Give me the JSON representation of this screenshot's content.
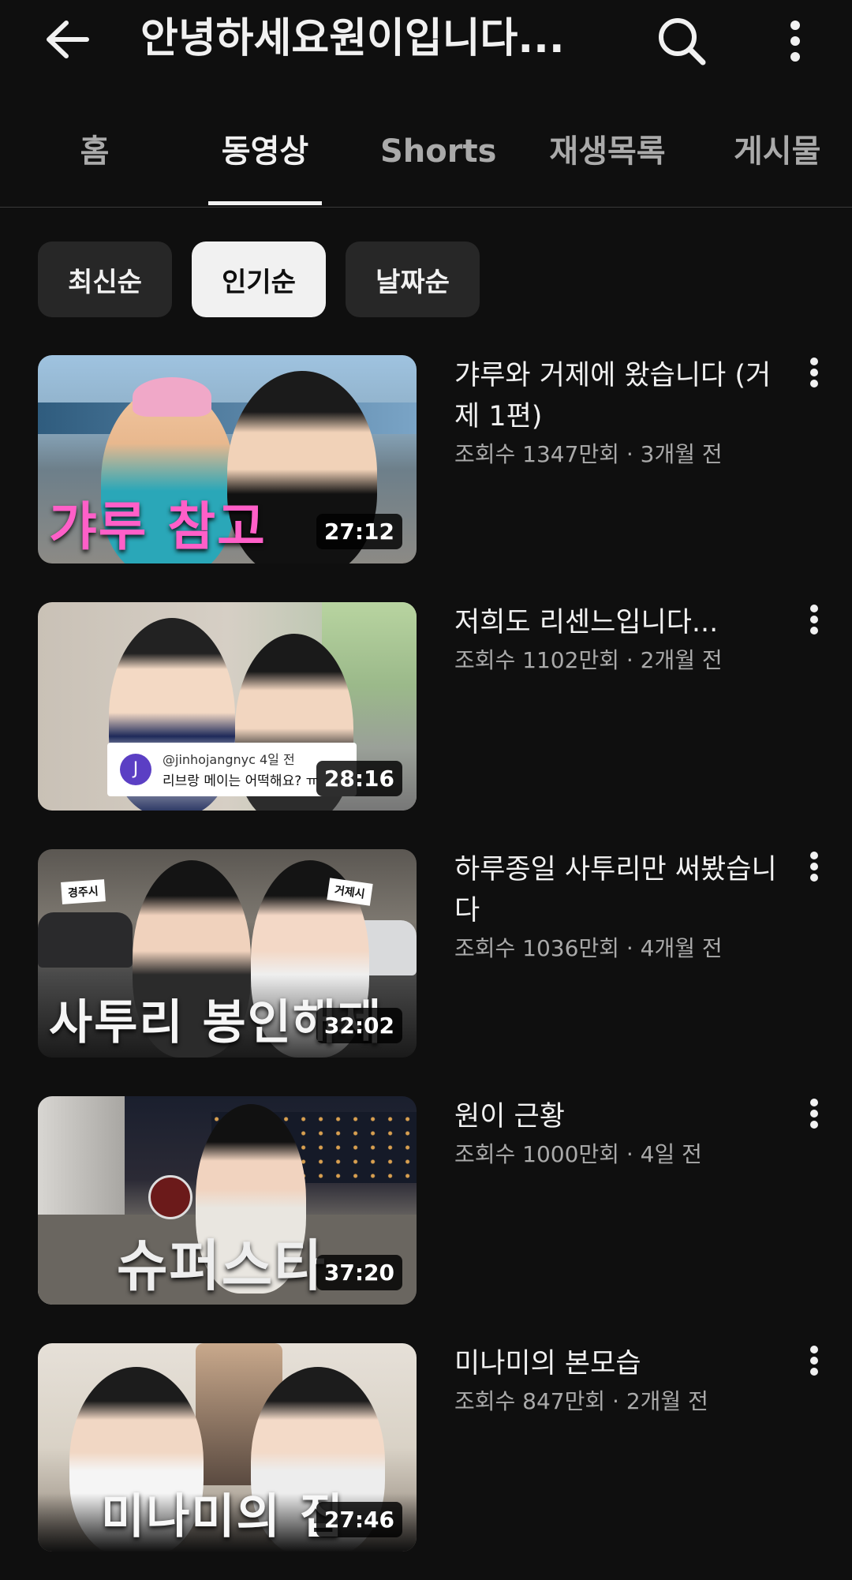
{
  "header": {
    "back_icon": "arrow-left-icon",
    "title": "안녕하세요원이입니다...",
    "search_icon": "search-icon",
    "more_icon": "more-vert-icon"
  },
  "tabs": [
    {
      "label": "홈",
      "active": false
    },
    {
      "label": "동영상",
      "active": true
    },
    {
      "label": "Shorts",
      "active": false
    },
    {
      "label": "재생목록",
      "active": false
    },
    {
      "label": "게시물",
      "active": false
    }
  ],
  "sort_chips": [
    {
      "label": "최신순",
      "active": false
    },
    {
      "label": "인기순",
      "active": true
    },
    {
      "label": "날짜순",
      "active": false
    }
  ],
  "videos": [
    {
      "title": "갸루와 거제에 왔습니다 (거제 1편)",
      "subtitle": "조회수 1347만회 · 3개월 전",
      "duration": "27:12",
      "thumb_caption": "갸루 참고",
      "thumb_caption_color": "#ff5fc8"
    },
    {
      "title": "저희도 리센느입니다...",
      "subtitle": "조회수 1102만회 · 2개월 전",
      "duration": "28:16",
      "comment_avatar": "J",
      "comment_user": "@jinhojangnyc 4일 전",
      "comment_text": "리브랑 메이는 어떡해요? ㅠ"
    },
    {
      "title": "하루종일 사투리만 써봤습니다",
      "subtitle": "조회수 1036만회 · 4개월 전",
      "duration": "32:02",
      "thumb_caption": "사투리 봉인해제",
      "sign_left": "경주시",
      "sign_right": "거제시"
    },
    {
      "title": "원이 근황",
      "subtitle": "조회수 1000만회 · 4일 전",
      "duration": "37:20",
      "thumb_caption": "슈퍼스타"
    },
    {
      "title": "미나미의 본모습",
      "subtitle": "조회수 847만회 · 2개월 전",
      "duration": "27:46",
      "thumb_caption": "미나미의 집"
    }
  ]
}
